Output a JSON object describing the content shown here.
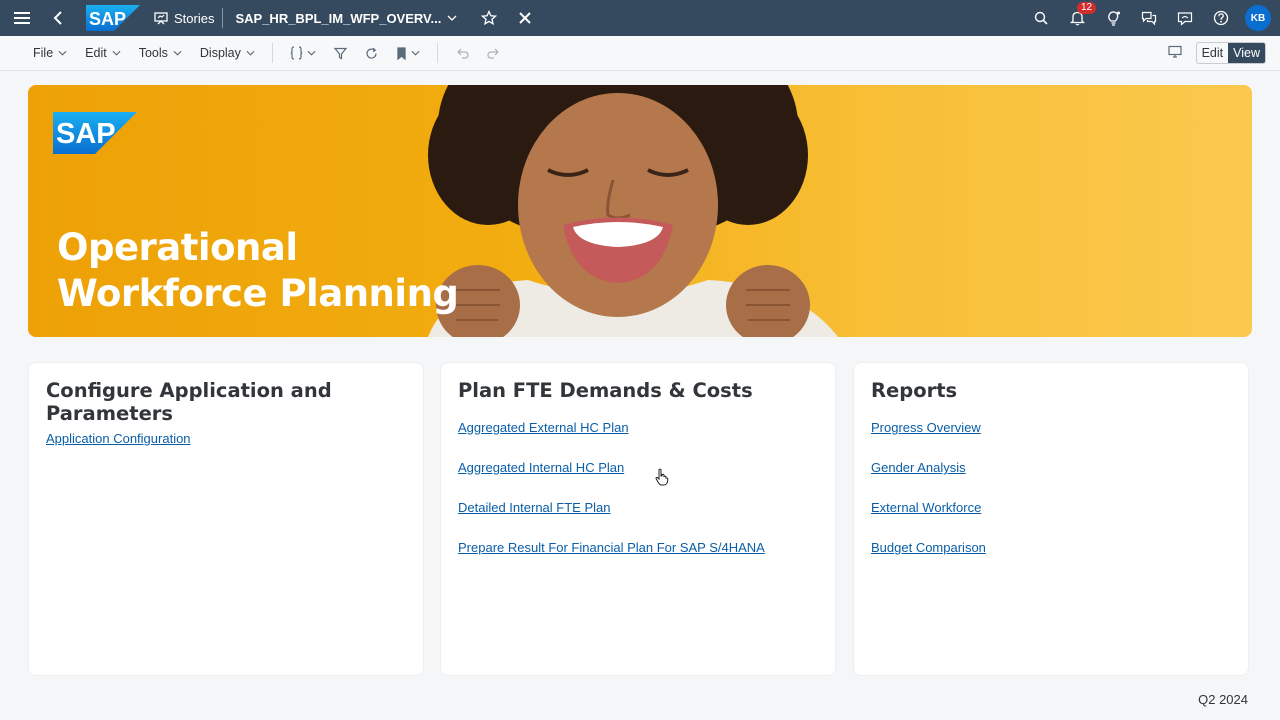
{
  "shell": {
    "stories_label": "Stories",
    "story_title": "SAP_HR_BPL_IM_WFP_OVERV...",
    "notification_count": "12",
    "avatar_initials": "KB"
  },
  "toolbar": {
    "menus": [
      "File",
      "Edit",
      "Tools",
      "Display"
    ],
    "edit_label": "Edit",
    "view_label": "View"
  },
  "hero": {
    "logo_text": "SAP",
    "title_line1": "Operational",
    "title_line2": "Workforce Planning"
  },
  "cards": [
    {
      "title": "Configure Application and Parameters",
      "links": [
        "Application Configuration"
      ]
    },
    {
      "title": "Plan FTE Demands & Costs",
      "links": [
        "Aggregated External HC Plan",
        "Aggregated Internal HC Plan",
        "Detailed Internal FTE Plan",
        "Prepare Result For Financial Plan For SAP S/4HANA"
      ]
    },
    {
      "title": "Reports",
      "links": [
        "Progress Overview",
        "Gender Analysis",
        "External Workforce",
        "Budget Comparison"
      ]
    }
  ],
  "footer": {
    "period": "Q2 2024"
  },
  "colors": {
    "shell": "#354a5f",
    "link": "#0a5ea8",
    "banner": "#f2ad10",
    "sap_blue": "#0a6ed1"
  }
}
